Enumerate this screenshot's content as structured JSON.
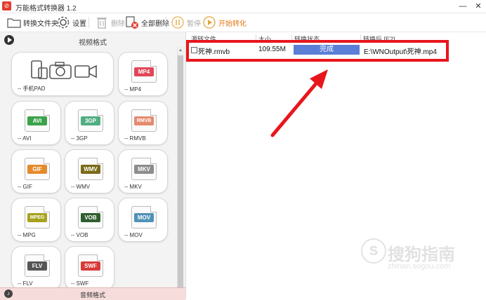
{
  "window": {
    "title": "万能格式转换器 1.2",
    "minimize_glyph": "—",
    "close_glyph": "✕"
  },
  "toolbar": {
    "convert_folder": "转换文件夹",
    "settings": "设置",
    "delete": "删除",
    "delete_all": "全部删除",
    "pause": "暂停",
    "start_convert": "开始转化"
  },
  "sidebar": {
    "video_formats_title": "视频格式",
    "audio_formats_title": "音频格式",
    "tiles": [
      {
        "caption": "-- 手机PAD",
        "icon": "phone-camera-video-icon"
      },
      {
        "caption": "-- MP4",
        "badge": "MP4",
        "color": "#e04757"
      },
      {
        "caption": "-- AVI",
        "badge": "AVI",
        "color": "#3aa34a"
      },
      {
        "caption": "-- 3GP",
        "badge": "3GP",
        "color": "#4fae82"
      },
      {
        "caption": "-- RMVB",
        "badge": "RMVB",
        "color": "#e58b70"
      },
      {
        "caption": "-- GIF",
        "badge": "GIF",
        "color": "#e58a2c"
      },
      {
        "caption": "-- WMV",
        "badge": "WMV",
        "color": "#7a6a18"
      },
      {
        "caption": "-- MKV",
        "badge": "MKV",
        "color": "#8c8c8c"
      },
      {
        "caption": "-- MPG",
        "badge": "MPEG",
        "color": "#a7a21e"
      },
      {
        "caption": "-- VOB",
        "badge": "VOB",
        "color": "#2f5d2f"
      },
      {
        "caption": "-- MOV",
        "badge": "MOV",
        "color": "#4f93b8"
      },
      {
        "caption": "-- FLV",
        "badge": "FLV",
        "color": "#555555"
      },
      {
        "caption": "-- SWF",
        "badge": "SWF",
        "color": "#d93a3a"
      }
    ]
  },
  "file_table": {
    "columns": [
      "源转文件",
      "大小",
      "转换状态",
      "转换后 [E2]"
    ],
    "rows": [
      {
        "name": "死神.rmvb",
        "size": "109.55M",
        "status": "完成",
        "output": "E:\\WNOutput\\死神.mp4"
      }
    ]
  },
  "watermark": {
    "logo_char": "S",
    "main": "搜狗指南",
    "sub": "zhinan.sogou.com"
  },
  "colors": {
    "highlight": "#e8161c",
    "arrow": "#e8161c",
    "status_fill": "#5b7fd6"
  }
}
